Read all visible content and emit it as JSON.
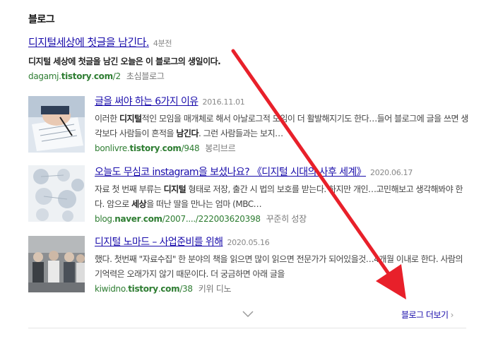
{
  "section": {
    "title": "블로그"
  },
  "posts": [
    {
      "title": "디지털세상에 첫글을 남긴다.",
      "date": "4분전",
      "snippet": "디지털 세상에 첫글을 남긴 오늘은 이 블로그의 생일이다.",
      "url_pre": "dagamj.",
      "url_bold": "tistory",
      "url_mid": ".",
      "url_bold2": "com",
      "url_post": "/2",
      "source": "초심블로그"
    },
    {
      "title": "글을 써야 하는 6가지 이유",
      "date": "2016.11.01",
      "snippet_a": "이러한 ",
      "snippet_b": "디지털",
      "snippet_c": "적인 모임을 매개체로 해서 아날로그적 모임이 더 활발해지기도 한다…들어 블로그에 글을 쓰면 생각보다 사람들이 흔적을 ",
      "snippet_d": "남긴다",
      "snippet_e": ". 그런 사람들과는 보지…",
      "url_pre": "bonlivre.",
      "url_bold": "tistory",
      "url_mid": ".",
      "url_bold2": "com",
      "url_post": "/948",
      "source": "봉리브르"
    },
    {
      "title": "오늘도 무심코 instagram을 보셨나요? 《디지털 시대의 사후 세계》",
      "date": "2020.06.17",
      "snippet_a": "자료  첫 번째 부류는 ",
      "snippet_b": "디지털",
      "snippet_c": " 형태로 저장, 출간 시 법의 보호를 받는다. 하지만 개인…고민해보고 생각해봐야 한다.   암으로 ",
      "snippet_d": "세상",
      "snippet_e": "을 떠난 딸을 만나는 엄마 (MBC…",
      "url_pre": "blog.",
      "url_bold": "naver",
      "url_mid": ".",
      "url_bold2": "com",
      "url_post": "/2007..../222003620398",
      "source": "꾸준히 성장"
    },
    {
      "title": "디지털 노마드 – 사업준비를 위해",
      "date": "2020.05.16",
      "snippet": "했다. 첫번째 \"자료수집\" 한 분야의 책을 읽으면 많이 읽으면 전문가가 되어있을것…4개월 이내로 한다. 사람의 기억력은 오래가지 않기 때문이다. 더 궁금하면 아래 글을",
      "url_pre": "kiwidno.",
      "url_bold": "tistory",
      "url_mid": ".",
      "url_bold2": "com",
      "url_post": "/38",
      "source": "키위 디노"
    }
  ],
  "footer": {
    "more_label": "블로그 더보기",
    "more_chevron": "›"
  },
  "icons": {
    "expand": "chevron-down-icon",
    "thumb1": "writing-photo",
    "thumb2": "diagram-photo",
    "thumb3": "people-photo"
  },
  "colors": {
    "link": "#1a0dab",
    "url": "#2e7d32",
    "annotation": "#e8202a"
  }
}
